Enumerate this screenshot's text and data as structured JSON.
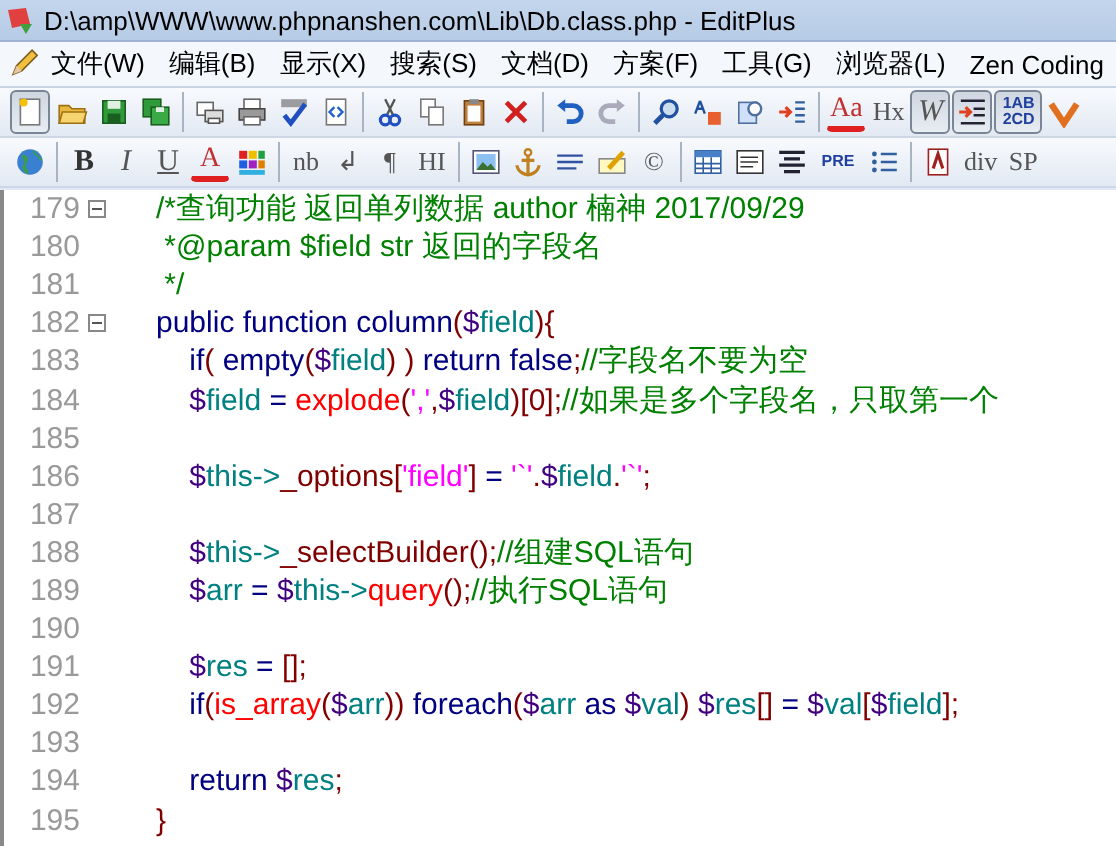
{
  "window": {
    "title": "D:\\amp\\WWW\\www.phpnanshen.com\\Lib\\Db.class.php - EditPlus"
  },
  "menu": [
    "文件(W)",
    "编辑(B)",
    "显示(X)",
    "搜索(S)",
    "文档(D)",
    "方案(F)",
    "工具(G)",
    "浏览器(L)",
    "Zen Coding"
  ],
  "toolbars": [
    [
      {
        "kind": "icon",
        "pressed": true
      },
      {
        "kind": "icon",
        "pressed": false
      },
      {
        "kind": "icon",
        "pressed": false
      },
      {
        "kind": "icon",
        "pressed": false
      },
      {
        "kind": "separator"
      },
      {
        "kind": "icon",
        "pressed": false
      },
      {
        "kind": "icon",
        "pressed": false
      },
      {
        "kind": "icon",
        "pressed": false
      },
      {
        "kind": "icon",
        "pressed": false
      },
      {
        "kind": "separator"
      },
      {
        "kind": "icon",
        "pressed": false
      },
      {
        "kind": "icon",
        "pressed": false
      },
      {
        "kind": "icon",
        "pressed": false
      },
      {
        "kind": "icon",
        "pressed": false
      },
      {
        "kind": "separator"
      },
      {
        "kind": "icon",
        "pressed": false
      },
      {
        "kind": "icon",
        "pressed": false
      },
      {
        "kind": "separator"
      },
      {
        "kind": "icon",
        "pressed": false
      },
      {
        "kind": "icon",
        "pressed": false
      },
      {
        "kind": "icon",
        "pressed": false
      },
      {
        "kind": "icon",
        "pressed": false
      },
      {
        "kind": "separator"
      },
      {
        "kind": "fontcolor",
        "label": "Aa",
        "pressed": false
      },
      {
        "kind": "text",
        "label": "Hx",
        "pressed": false
      },
      {
        "kind": "italic",
        "label": "W",
        "pressed": true
      },
      {
        "kind": "icon",
        "pressed": true
      },
      {
        "kind": "tiny",
        "label": "1AB 2CD",
        "pressed": true
      },
      {
        "kind": "icon",
        "pressed": false
      }
    ],
    [
      {
        "kind": "icon",
        "pressed": false
      },
      {
        "kind": "separator"
      },
      {
        "kind": "bold",
        "label": "B",
        "pressed": false
      },
      {
        "kind": "italic",
        "label": "I",
        "pressed": false
      },
      {
        "kind": "underline",
        "label": "U",
        "pressed": false
      },
      {
        "kind": "fontcolor",
        "label": "A",
        "pressed": false
      },
      {
        "kind": "icon",
        "pressed": false
      },
      {
        "kind": "separator"
      },
      {
        "kind": "text",
        "label": "nb",
        "pressed": false
      },
      {
        "kind": "text",
        "label": "↲",
        "pressed": false
      },
      {
        "kind": "text",
        "label": "¶",
        "pressed": false
      },
      {
        "kind": "text",
        "label": "HI",
        "pressed": false
      },
      {
        "kind": "separator"
      },
      {
        "kind": "icon",
        "pressed": false
      },
      {
        "kind": "icon",
        "pressed": false
      },
      {
        "kind": "icon",
        "pressed": false
      },
      {
        "kind": "icon",
        "pressed": false
      },
      {
        "kind": "text",
        "label": "©",
        "pressed": false
      },
      {
        "kind": "separator"
      },
      {
        "kind": "icon",
        "pressed": false
      },
      {
        "kind": "icon",
        "pressed": false
      },
      {
        "kind": "icon",
        "pressed": false
      },
      {
        "kind": "tiny",
        "label": "PRE",
        "pressed": false
      },
      {
        "kind": "icon",
        "pressed": false
      },
      {
        "kind": "separator"
      },
      {
        "kind": "icon",
        "pressed": false
      },
      {
        "kind": "text",
        "label": "div",
        "pressed": false
      },
      {
        "kind": "text",
        "label": "SP",
        "pressed": false
      }
    ]
  ],
  "editor": {
    "lines": [
      {
        "number": "179",
        "foldable": true,
        "tokens": [
          {
            "text": "/*查询功能 返回单列数据 author 楠神 2017/09/29",
            "kind": "comment"
          }
        ]
      },
      {
        "number": "180",
        "foldable": false,
        "tokens": [
          {
            "text": " *@param $field str 返回的字段名",
            "kind": "comment"
          }
        ]
      },
      {
        "number": "181",
        "foldable": false,
        "tokens": [
          {
            "text": " */",
            "kind": "comment"
          }
        ]
      },
      {
        "number": "182",
        "foldable": true,
        "tokens": [
          {
            "text": "public function column",
            "kind": "keyword"
          },
          {
            "text": "(",
            "kind": "punct"
          },
          {
            "text": "$",
            "kind": "dollar"
          },
          {
            "text": "field",
            "kind": "variable"
          },
          {
            "text": "){",
            "kind": "punct"
          }
        ]
      },
      {
        "number": "183",
        "foldable": false,
        "tokens": [
          {
            "text": "    if",
            "kind": "keyword"
          },
          {
            "text": "(",
            "kind": "punct"
          },
          {
            "text": " empty",
            "kind": "keyword"
          },
          {
            "text": "(",
            "kind": "punct"
          },
          {
            "text": "$",
            "kind": "dollar"
          },
          {
            "text": "field",
            "kind": "variable"
          },
          {
            "text": ") ) ",
            "kind": "punct"
          },
          {
            "text": "return false",
            "kind": "keyword"
          },
          {
            "text": ";",
            "kind": "punct"
          },
          {
            "text": "//字段名不要为空",
            "kind": "comment"
          }
        ]
      },
      {
        "number": "184",
        "foldable": false,
        "tokens": [
          {
            "text": "    $",
            "kind": "dollar"
          },
          {
            "text": "field",
            "kind": "variable"
          },
          {
            "text": " = ",
            "kind": "keyword"
          },
          {
            "text": "explode",
            "kind": "function"
          },
          {
            "text": "(",
            "kind": "punct"
          },
          {
            "text": "','",
            "kind": "string"
          },
          {
            "text": ",",
            "kind": "punct"
          },
          {
            "text": "$",
            "kind": "dollar"
          },
          {
            "text": "field",
            "kind": "variable"
          },
          {
            "text": ")[0];",
            "kind": "punct"
          },
          {
            "text": "//如果是多个字段名，只取第一个",
            "kind": "comment"
          }
        ]
      },
      {
        "number": "185",
        "foldable": false
      },
      {
        "number": "186",
        "foldable": false,
        "tokens": [
          {
            "text": "    $",
            "kind": "dollar"
          },
          {
            "text": "this->",
            "kind": "variable"
          },
          {
            "text": "_options",
            "kind": "member"
          },
          {
            "text": "[",
            "kind": "punct"
          },
          {
            "text": "'field'",
            "kind": "string"
          },
          {
            "text": "]",
            "kind": "punct"
          },
          {
            "text": " = ",
            "kind": "keyword"
          },
          {
            "text": "'`'",
            "kind": "string"
          },
          {
            "text": ".",
            "kind": "punct"
          },
          {
            "text": "$",
            "kind": "dollar"
          },
          {
            "text": "field",
            "kind": "variable"
          },
          {
            "text": ".",
            "kind": "punct"
          },
          {
            "text": "'`'",
            "kind": "string"
          },
          {
            "text": ";",
            "kind": "punct"
          }
        ]
      },
      {
        "number": "187",
        "foldable": false
      },
      {
        "number": "188",
        "foldable": false,
        "tokens": [
          {
            "text": "    $",
            "kind": "dollar"
          },
          {
            "text": "this->",
            "kind": "variable"
          },
          {
            "text": "_selectBuilder();",
            "kind": "member"
          },
          {
            "text": "//组建SQL语句",
            "kind": "comment"
          }
        ]
      },
      {
        "number": "189",
        "foldable": false,
        "tokens": [
          {
            "text": "    $",
            "kind": "dollar"
          },
          {
            "text": "arr",
            "kind": "variable"
          },
          {
            "text": " = ",
            "kind": "keyword"
          },
          {
            "text": "$",
            "kind": "dollar"
          },
          {
            "text": "this->",
            "kind": "variable"
          },
          {
            "text": "query",
            "kind": "function"
          },
          {
            "text": "();",
            "kind": "punct"
          },
          {
            "text": "//执行SQL语句",
            "kind": "comment"
          }
        ]
      },
      {
        "number": "190",
        "foldable": false
      },
      {
        "number": "191",
        "foldable": false,
        "tokens": [
          {
            "text": "    $",
            "kind": "dollar"
          },
          {
            "text": "res",
            "kind": "variable"
          },
          {
            "text": " = ",
            "kind": "keyword"
          },
          {
            "text": "[];",
            "kind": "punct"
          }
        ]
      },
      {
        "number": "192",
        "foldable": false,
        "tokens": [
          {
            "text": "    if",
            "kind": "keyword"
          },
          {
            "text": "(",
            "kind": "punct"
          },
          {
            "text": "is_array",
            "kind": "function"
          },
          {
            "text": "(",
            "kind": "punct"
          },
          {
            "text": "$",
            "kind": "dollar"
          },
          {
            "text": "arr",
            "kind": "variable"
          },
          {
            "text": "))",
            "kind": "punct"
          },
          {
            "text": " foreach",
            "kind": "keyword"
          },
          {
            "text": "(",
            "kind": "punct"
          },
          {
            "text": "$",
            "kind": "dollar"
          },
          {
            "text": "arr",
            "kind": "variable"
          },
          {
            "text": " as ",
            "kind": "keyword"
          },
          {
            "text": "$",
            "kind": "dollar"
          },
          {
            "text": "val",
            "kind": "variable"
          },
          {
            "text": ") ",
            "kind": "punct"
          },
          {
            "text": "$",
            "kind": "dollar"
          },
          {
            "text": "res",
            "kind": "variable"
          },
          {
            "text": "[]",
            "kind": "punct"
          },
          {
            "text": " = ",
            "kind": "keyword"
          },
          {
            "text": "$",
            "kind": "dollar"
          },
          {
            "text": "val",
            "kind": "variable"
          },
          {
            "text": "[",
            "kind": "punct"
          },
          {
            "text": "$",
            "kind": "dollar"
          },
          {
            "text": "field",
            "kind": "variable"
          },
          {
            "text": "];",
            "kind": "punct"
          }
        ]
      },
      {
        "number": "193",
        "foldable": false
      },
      {
        "number": "194",
        "foldable": false,
        "tokens": [
          {
            "text": "    return ",
            "kind": "keyword"
          },
          {
            "text": "$",
            "kind": "dollar"
          },
          {
            "text": "res",
            "kind": "variable"
          },
          {
            "text": ";",
            "kind": "punct"
          }
        ]
      },
      {
        "number": "195",
        "foldable": false,
        "tokens": [
          {
            "text": "}",
            "kind": "punct"
          }
        ]
      }
    ]
  }
}
